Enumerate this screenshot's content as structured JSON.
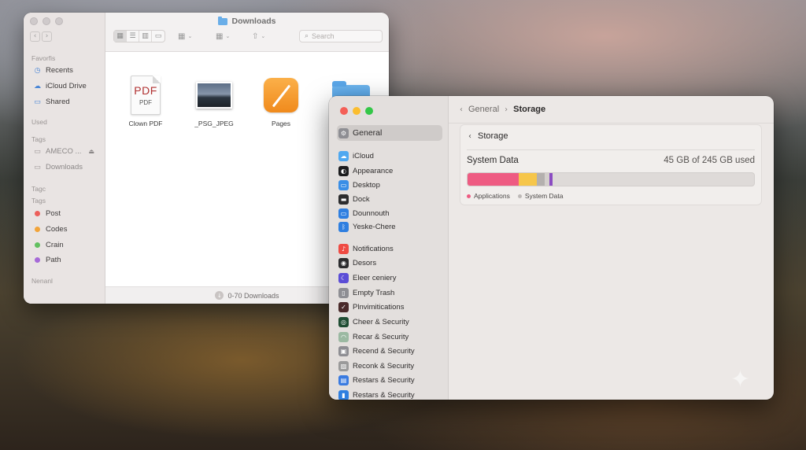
{
  "finder": {
    "title": "Downloads",
    "search_placeholder": "Search",
    "status_text": "0-70 Downloads",
    "sidebar": {
      "favorites_header": "Favorfis",
      "favorites": [
        {
          "label": "Recents",
          "icon": "clock-icon"
        },
        {
          "label": "iCloud Drive",
          "icon": "cloud-icon"
        },
        {
          "label": "Shared",
          "icon": "shared-folder-icon"
        }
      ],
      "used_header": "Used",
      "tags_header_1": "Tags",
      "locations": [
        {
          "label": "AMECO ...",
          "eject": "⏏"
        },
        {
          "label": "Downloads"
        }
      ],
      "tags_header_2": "Tagc",
      "tags_header_3": "Tags",
      "tags": [
        {
          "label": "Post",
          "color": "#ec5f5a"
        },
        {
          "label": "Codes",
          "color": "#f2a43a"
        },
        {
          "label": "Crain",
          "color": "#62c060"
        },
        {
          "label": "Path",
          "color": "#a66ad8"
        }
      ],
      "footer_header": "Nenanl"
    },
    "files": [
      {
        "name": "Clown PDF",
        "type": "pdf",
        "badge_big": "PDF",
        "badge_small": "PDF"
      },
      {
        "name": "_PSG_JPEG",
        "type": "jpeg"
      },
      {
        "name": "Pages",
        "type": "pages-app"
      },
      {
        "name": "",
        "type": "folder"
      }
    ]
  },
  "settings": {
    "sidebar": {
      "selected": "General",
      "items": [
        {
          "label": "General",
          "icon": "gear-icon",
          "color": "#8e8e93"
        },
        {
          "label": "iCloud",
          "icon": "cloud-icon",
          "color": "#4fa8f0"
        },
        {
          "label": "Appearance",
          "icon": "appearance-icon",
          "color": "#1c1c1e"
        },
        {
          "label": "Desktop",
          "icon": "desktop-icon",
          "color": "#3a8ee6"
        },
        {
          "label": "Dock",
          "icon": "dock-icon",
          "color": "#2c2c2e"
        },
        {
          "label": "Dounnouth",
          "icon": "display-icon",
          "color": "#2f7fe0"
        },
        {
          "label": "Yeske-Chere",
          "icon": "bluetooth-icon",
          "color": "#2f7fe0"
        },
        {
          "label": "Notifications",
          "icon": "bell-icon",
          "color": "#ef4b43"
        },
        {
          "label": "Desors",
          "icon": "sound-icon",
          "color": "#2c2c2e"
        },
        {
          "label": "Eleer ceniery",
          "icon": "focus-icon",
          "color": "#5b4dd6"
        },
        {
          "label": "Empty Trash",
          "icon": "trash-icon",
          "color": "#8e8e93"
        },
        {
          "label": "Plnvimitications",
          "icon": "screen-time-icon",
          "color": "#4a2a2a"
        },
        {
          "label": "Cheer & Security",
          "icon": "shield-icon",
          "color": "#1f4d33"
        },
        {
          "label": "Recar & Security",
          "icon": "privacy-icon",
          "color": "#9bb9a2"
        },
        {
          "label": "Recend & Security",
          "icon": "lock-icon",
          "color": "#8e8e93"
        },
        {
          "label": "Reconk & Security",
          "icon": "wallpaper-icon",
          "color": "#9a9a9a"
        },
        {
          "label": "Restars & Security",
          "icon": "screensaver-icon",
          "color": "#3a7be0"
        },
        {
          "label": "Restars & Security",
          "icon": "battery-icon",
          "color": "#2f7fe0"
        }
      ]
    },
    "breadcrumb": {
      "parent": "General",
      "current": "Storage"
    },
    "storage": {
      "header": "Storage",
      "label": "System Data",
      "used_text": "45 GB of 245 GB used",
      "segments": [
        {
          "name": "Applications",
          "fraction": 0.178,
          "color": "#ee5b82"
        },
        {
          "name": "other-yellow",
          "fraction": 0.065,
          "color": "#f6c64a"
        },
        {
          "name": "other-gray",
          "fraction": 0.025,
          "color": "#b4b0ae"
        },
        {
          "name": "other-light",
          "fraction": 0.018,
          "color": "#d4cfcc"
        },
        {
          "name": "System Data",
          "fraction": 0.012,
          "color": "#8b4cc2"
        }
      ],
      "legend": [
        {
          "label": "Applications",
          "color": "#ee5b82"
        },
        {
          "label": "System Data",
          "color": "#bdb9b7"
        }
      ]
    }
  }
}
